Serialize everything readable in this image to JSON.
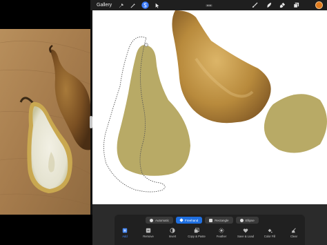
{
  "toolbar": {
    "gallery_label": "Gallery",
    "tools": [
      {
        "name": "wrench",
        "icon": "wrench-icon"
      },
      {
        "name": "adjustments",
        "icon": "magic-wand-icon"
      },
      {
        "name": "selection",
        "icon": "selection-s-icon"
      },
      {
        "name": "transform",
        "icon": "arrow-cursor-icon"
      }
    ],
    "brushes": [
      {
        "name": "paint",
        "icon": "brush-icon"
      },
      {
        "name": "smudge",
        "icon": "smudge-icon"
      },
      {
        "name": "erase",
        "icon": "eraser-icon"
      },
      {
        "name": "layers",
        "icon": "layers-icon"
      }
    ],
    "more_icon": "ellipsis-icon",
    "accent_color": "#3a7bff",
    "current_color": "#e07a1c"
  },
  "selection": {
    "modes": [
      {
        "label": "Automatic",
        "active": false
      },
      {
        "label": "Freehand",
        "active": true
      },
      {
        "label": "Rectangle",
        "active": false
      },
      {
        "label": "Ellipse",
        "active": false
      }
    ],
    "actions": [
      {
        "label": "Add",
        "icon": "add-icon",
        "primary": true
      },
      {
        "label": "Remove",
        "icon": "remove-icon",
        "primary": false
      },
      {
        "label": "Invert",
        "icon": "invert-icon",
        "primary": false
      },
      {
        "label": "Copy & Paste",
        "icon": "copy-paste-icon",
        "primary": false
      },
      {
        "label": "Feather",
        "icon": "feather-icon",
        "primary": false
      },
      {
        "label": "Save & Load",
        "icon": "save-load-icon",
        "primary": false
      },
      {
        "label": "Color Fill",
        "icon": "color-fill-icon",
        "primary": false
      },
      {
        "label": "Clear",
        "icon": "clear-icon",
        "primary": false
      }
    ]
  },
  "colors": {
    "pear_fill": "#b8aa66",
    "accent_blue": "#1f6fe0",
    "panel_bg": "#202020"
  }
}
